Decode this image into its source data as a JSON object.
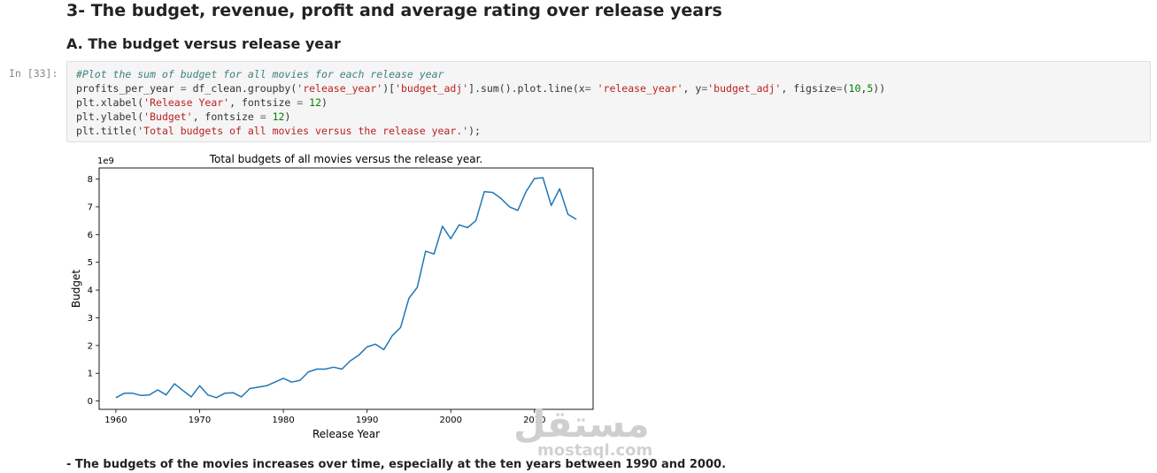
{
  "heading": "3- The budget, revenue, profit and average rating over release years",
  "subheading": "A. The budget versus release year",
  "cell": {
    "prompt": "In [33]:",
    "comment": "#Plot the sum of budget for all movies for each release year",
    "line2": {
      "a": "profits_per_year ",
      "eq": "=",
      "b": " df_clean.groupby(",
      "s1": "'release_year'",
      "c": ")[",
      "s2": "'budget_adj'",
      "d": "].sum().plot.line(x",
      "eq2": "=",
      "e": " ",
      "s3": "'release_year'",
      "f": ", y",
      "eq3": "=",
      "s4": "'budget_adj'",
      "g": ", figsize",
      "eq4": "=",
      "h": "(",
      "n1": "10",
      "i": ",",
      "n2": "5",
      "j": "))"
    },
    "line3": {
      "a": "plt.xlabel(",
      "s": "'Release Year'",
      "b": ", fontsize ",
      "eq": "=",
      "c": " ",
      "n": "12",
      "d": ")"
    },
    "line4": {
      "a": "plt.ylabel(",
      "s": "'Budget'",
      "b": ", fontsize ",
      "eq": "=",
      "c": " ",
      "n": "12",
      "d": ")"
    },
    "line5": {
      "a": "plt.title(",
      "s": "'Total budgets of all movies versus the release year.'",
      "b": ");"
    }
  },
  "chart_data": {
    "type": "line",
    "title": "Total budgets of all movies versus the release year.",
    "xlabel": "Release Year",
    "ylabel": "Budget",
    "offset_label": "1e9",
    "xlim": [
      1958,
      2017
    ],
    "ylim": [
      -0.3,
      8.4
    ],
    "x_ticks": [
      1960,
      1970,
      1980,
      1990,
      2000,
      2010
    ],
    "y_ticks": [
      0,
      1,
      2,
      3,
      4,
      5,
      6,
      7,
      8
    ],
    "grid": false,
    "color": "#1f77b4",
    "series": [
      {
        "x": [
          1960,
          1961,
          1962,
          1963,
          1964,
          1965,
          1966,
          1967,
          1968,
          1969,
          1970,
          1971,
          1972,
          1973,
          1974,
          1975,
          1976,
          1977,
          1978,
          1979,
          1980,
          1981,
          1982,
          1983,
          1984,
          1985,
          1986,
          1987,
          1988,
          1989,
          1990,
          1991,
          1992,
          1993,
          1994,
          1995,
          1996,
          1997,
          1998,
          1999,
          2000,
          2001,
          2002,
          2003,
          2004,
          2005,
          2006,
          2007,
          2008,
          2009,
          2010,
          2011,
          2012,
          2013,
          2014,
          2015
        ],
        "values": [
          0.12,
          0.28,
          0.28,
          0.2,
          0.22,
          0.4,
          0.22,
          0.62,
          0.38,
          0.15,
          0.55,
          0.22,
          0.12,
          0.28,
          0.3,
          0.15,
          0.45,
          0.5,
          0.55,
          0.68,
          0.82,
          0.68,
          0.75,
          1.05,
          1.15,
          1.15,
          1.22,
          1.15,
          1.45,
          1.65,
          1.95,
          2.05,
          1.85,
          2.35,
          2.65,
          3.7,
          4.1,
          5.4,
          5.3,
          6.3,
          5.85,
          6.35,
          6.25,
          6.5,
          7.55,
          7.52,
          7.3,
          7.0,
          6.87,
          7.55,
          8.02,
          8.05,
          7.05,
          7.65,
          6.73,
          6.55
        ]
      }
    ]
  },
  "markdown": "- The budgets of the movies increases over time, especially at the ten years between 1990 and 2000.",
  "watermark": {
    "arabic": "مستقل",
    "latin": "mostaql.com"
  }
}
